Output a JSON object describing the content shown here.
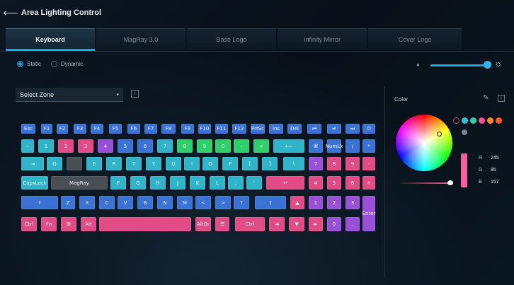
{
  "window": {
    "title": "Area Lighting Control",
    "back_icon": "back-arrow-icon"
  },
  "tabs": [
    {
      "label": "Keyboard",
      "active": true
    },
    {
      "label": "MagRay 3.0",
      "active": false
    },
    {
      "label": "Base Logo",
      "active": false
    },
    {
      "label": "Infinity Mirror",
      "active": false
    },
    {
      "label": "Cover Logo",
      "active": false
    }
  ],
  "mode": {
    "static_label": "Static",
    "dynamic_label": "Dynamic",
    "selected": "Static"
  },
  "brightness": {
    "value_percent": 100
  },
  "zone": {
    "label": "Select Zone",
    "dropdown_icon": "chevron-down-icon"
  },
  "color_panel": {
    "label": "Color",
    "presets": [
      "#2ec4d6",
      "#2fd3a0",
      "#ff4b8d",
      "#ff8a1e",
      "#ff5a1e"
    ],
    "current_color": "#f55f9d",
    "rgb": {
      "r_label": "R",
      "g_label": "G",
      "b_label": "B",
      "r": "245",
      "g": "95",
      "b": "157"
    }
  },
  "keyboard": {
    "colors": {
      "blue": "#3b72d6",
      "teal": "#2fb4c9",
      "green": "#2fcf6c",
      "pink": "#e14b86",
      "purple": "#9a4fd8",
      "grey": "#4a4f55",
      "cyan": "#28a0cc"
    },
    "rows": [
      [
        [
          "Esc",
          "blue"
        ],
        [
          "F1",
          "blue"
        ],
        [
          "F2",
          "blue"
        ],
        [
          "F3",
          "blue"
        ],
        [
          "F4",
          "blue"
        ],
        [
          "F5",
          "blue"
        ],
        [
          "F6",
          "blue"
        ],
        [
          "F7",
          "blue"
        ],
        [
          "F8",
          "blue"
        ],
        [
          "F9",
          "blue"
        ],
        [
          "F10",
          "blue"
        ],
        [
          "F11",
          "blue"
        ],
        [
          "F12",
          "blue"
        ],
        [
          "PrtSc",
          "blue"
        ],
        [
          "Ins",
          "blue"
        ],
        [
          "Del",
          "blue"
        ],
        [
          "⏮",
          "blue"
        ],
        [
          "⏯",
          "blue"
        ],
        [
          "⏭",
          "blue"
        ],
        [
          "⏻",
          "blue"
        ]
      ],
      [
        [
          "~",
          "teal"
        ],
        [
          "1",
          "teal"
        ],
        [
          "2",
          "pink"
        ],
        [
          "3",
          "pink"
        ],
        [
          "4",
          "purple"
        ],
        [
          "5",
          "blue"
        ],
        [
          "6",
          "blue"
        ],
        [
          "7",
          "teal"
        ],
        [
          "8",
          "green"
        ],
        [
          "9",
          "green"
        ],
        [
          "0",
          "green"
        ],
        [
          "-",
          "green"
        ],
        [
          "+",
          "green"
        ],
        [
          "⟵",
          "teal"
        ],
        [
          "⌘",
          "blue"
        ],
        [
          "NumLk",
          "blue"
        ],
        [
          "/",
          "blue"
        ],
        [
          "*",
          "blue"
        ]
      ],
      [
        [
          "⇥",
          "teal"
        ],
        [
          "Q",
          "teal"
        ],
        [
          "",
          "grey"
        ],
        [
          "E",
          "teal"
        ],
        [
          "R",
          "teal"
        ],
        [
          "T",
          "teal"
        ],
        [
          "Y",
          "teal"
        ],
        [
          "U",
          "teal"
        ],
        [
          "I",
          "teal"
        ],
        [
          "O",
          "teal"
        ],
        [
          "P",
          "teal"
        ],
        [
          "[",
          "teal"
        ],
        [
          "]",
          "teal"
        ],
        [
          "\\",
          "teal"
        ],
        [
          "7",
          "purple"
        ],
        [
          "8",
          "pink"
        ],
        [
          "9",
          "pink"
        ],
        [
          "-",
          "pink"
        ]
      ],
      [
        [
          "CapsLock",
          "teal"
        ],
        [
          "MagRay",
          "grey"
        ],
        [
          "F",
          "teal"
        ],
        [
          "G",
          "teal"
        ],
        [
          "H",
          "teal"
        ],
        [
          "J",
          "teal"
        ],
        [
          "K",
          "teal"
        ],
        [
          "L",
          "teal"
        ],
        [
          ";",
          "teal"
        ],
        [
          "'",
          "teal"
        ],
        [
          "↵",
          "pink"
        ],
        [
          "4",
          "pink"
        ],
        [
          "5",
          "pink"
        ],
        [
          "6",
          "pink"
        ],
        [
          "+",
          "pink"
        ]
      ],
      [
        [
          "⇧",
          "blue"
        ],
        [
          "Z",
          "blue"
        ],
        [
          "X",
          "blue"
        ],
        [
          "C",
          "blue"
        ],
        [
          "V",
          "blue"
        ],
        [
          "B",
          "blue"
        ],
        [
          "N",
          "blue"
        ],
        [
          "M",
          "blue"
        ],
        [
          "<",
          "blue"
        ],
        [
          ">",
          "blue"
        ],
        [
          "?",
          "blue"
        ],
        [
          "⇧",
          "blue"
        ],
        [
          "▲",
          "pink"
        ],
        [
          "1",
          "purple"
        ],
        [
          "2",
          "purple"
        ],
        [
          "3",
          "purple"
        ],
        [
          "Enter",
          "purple"
        ]
      ],
      [
        [
          "Ctrl",
          "pink"
        ],
        [
          "Fn",
          "pink"
        ],
        [
          "⊞",
          "pink"
        ],
        [
          "Alt",
          "pink"
        ],
        [
          "",
          "pink"
        ],
        [
          "AltGr",
          "pink"
        ],
        [
          "☰",
          "pink"
        ],
        [
          "Ctrl",
          "pink"
        ],
        [
          "◄",
          "pink"
        ],
        [
          "▼",
          "pink"
        ],
        [
          "►",
          "pink"
        ],
        [
          "0",
          "purple"
        ],
        [
          ".",
          "purple"
        ]
      ]
    ]
  }
}
